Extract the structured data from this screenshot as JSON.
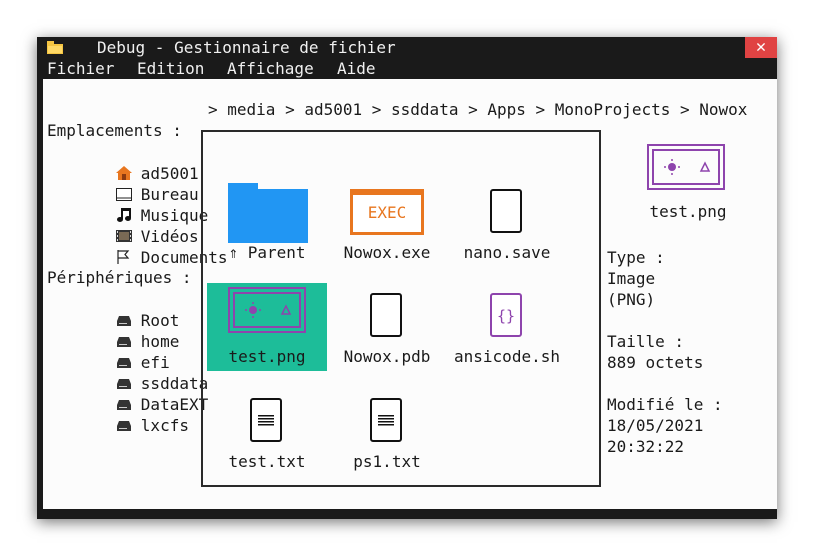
{
  "window": {
    "title": "Debug - Gestionnaire de fichier",
    "close_glyph": "✕"
  },
  "menu": [
    "Fichier",
    "Edition",
    "Affichage",
    "Aide"
  ],
  "path": "> media > ad5001 > ssddata > Apps > MonoProjects > Nowox",
  "sidebar": {
    "locations_title": "Emplacements :",
    "locations": [
      {
        "label": "ad5001",
        "icon": "home-icon"
      },
      {
        "label": "Bureau",
        "icon": "desktop-icon"
      },
      {
        "label": "Musique",
        "icon": "music-icon"
      },
      {
        "label": "Vidéos",
        "icon": "film-icon"
      },
      {
        "label": "Documents",
        "icon": "flag-icon"
      }
    ],
    "devices_title": "Périphériques :",
    "devices": [
      {
        "label": "Root",
        "icon": "drive-icon"
      },
      {
        "label": "home",
        "icon": "drive-icon"
      },
      {
        "label": "efi",
        "icon": "drive-icon"
      },
      {
        "label": "ssddata",
        "icon": "drive-icon"
      },
      {
        "label": "DataEXT",
        "icon": "drive-icon"
      },
      {
        "label": "lxcfs",
        "icon": "drive-icon"
      }
    ]
  },
  "files": [
    {
      "name": "⇑ Parent",
      "icon": "folder-icon"
    },
    {
      "name": "Nowox.exe",
      "icon": "exec-icon",
      "icon_text": "EXEC"
    },
    {
      "name": "nano.save",
      "icon": "file-icon"
    },
    {
      "name": "test.png",
      "icon": "image-icon",
      "selected": true
    },
    {
      "name": "Nowox.pdb",
      "icon": "file-icon"
    },
    {
      "name": "ansicode.sh",
      "icon": "script-icon",
      "icon_text": "{}"
    },
    {
      "name": "test.txt",
      "icon": "text-file-icon"
    },
    {
      "name": "ps1.txt",
      "icon": "text-file-icon"
    }
  ],
  "details": {
    "name": "test.png",
    "type_label": "Type :",
    "type_value_1": "Image",
    "type_value_2": "(PNG)",
    "size_label": "Taille :",
    "size_value": "889 octets",
    "modified_label": "Modifié le :",
    "modified_date": "18/05/2021",
    "modified_time": "20:32:22"
  },
  "colors": {
    "selection": "#1dbd99",
    "folder": "#2196f3",
    "exec": "#e8761f",
    "image": "#8e44ad",
    "close": "#e04343"
  }
}
